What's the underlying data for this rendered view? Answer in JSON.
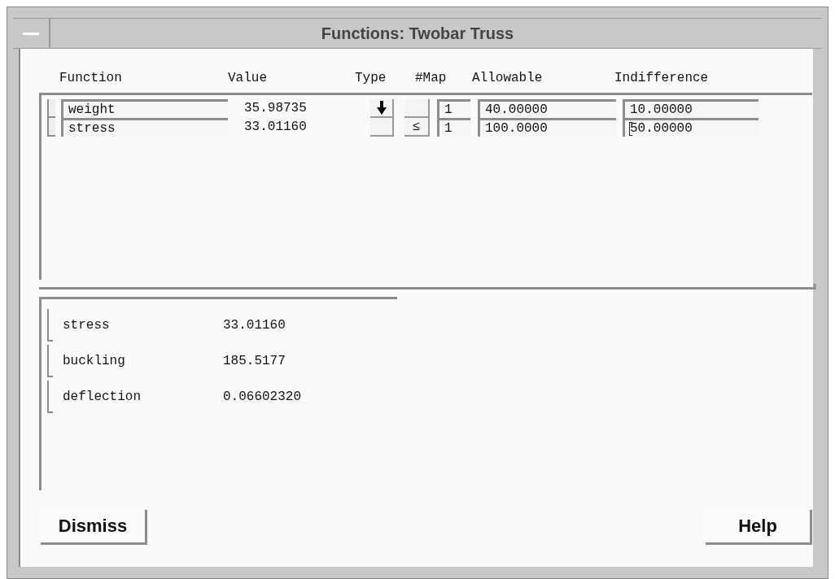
{
  "window": {
    "title": "Functions: Twobar Truss"
  },
  "columns": [
    "Function",
    "Value",
    "Type",
    "#Map",
    "Allowable",
    "Indifference"
  ],
  "functions": [
    {
      "name": "weight",
      "value": "35.98735",
      "kind": "minimize",
      "map": "1",
      "allowable": "40.00000",
      "indifference": "10.00000",
      "cursor": false
    },
    {
      "name": "stress",
      "value": "33.01160",
      "kind": "constraint",
      "symbol": "≤",
      "map": "1",
      "allowable": "100.0000",
      "indifference": "50.00000",
      "cursor": true
    }
  ],
  "outputs": [
    {
      "name": "stress",
      "value": "33.01160"
    },
    {
      "name": "buckling",
      "value": "185.5177"
    },
    {
      "name": "deflection",
      "value": "0.06602320"
    }
  ],
  "buttons": [
    "Dismiss",
    "Help"
  ]
}
